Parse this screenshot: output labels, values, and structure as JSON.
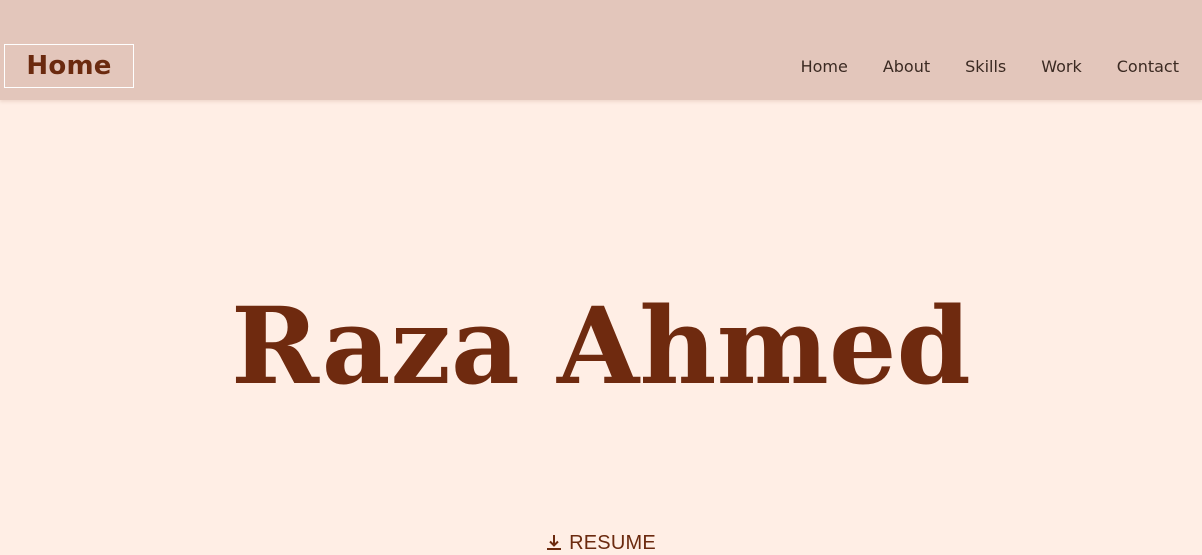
{
  "header": {
    "brand": "Home",
    "nav": [
      "Home",
      "About",
      "Skills",
      "Work",
      "Contact"
    ]
  },
  "hero": {
    "name": "Raza Ahmed",
    "resume_label": "RESUME"
  },
  "icons": {
    "download": "download-icon"
  },
  "colors": {
    "header_bg": "#e3c6bb",
    "page_bg": "#ffeee5",
    "brand_text": "#6b2a0f",
    "hero_text": "#6f2a0f",
    "nav_text": "#3b2a22"
  }
}
